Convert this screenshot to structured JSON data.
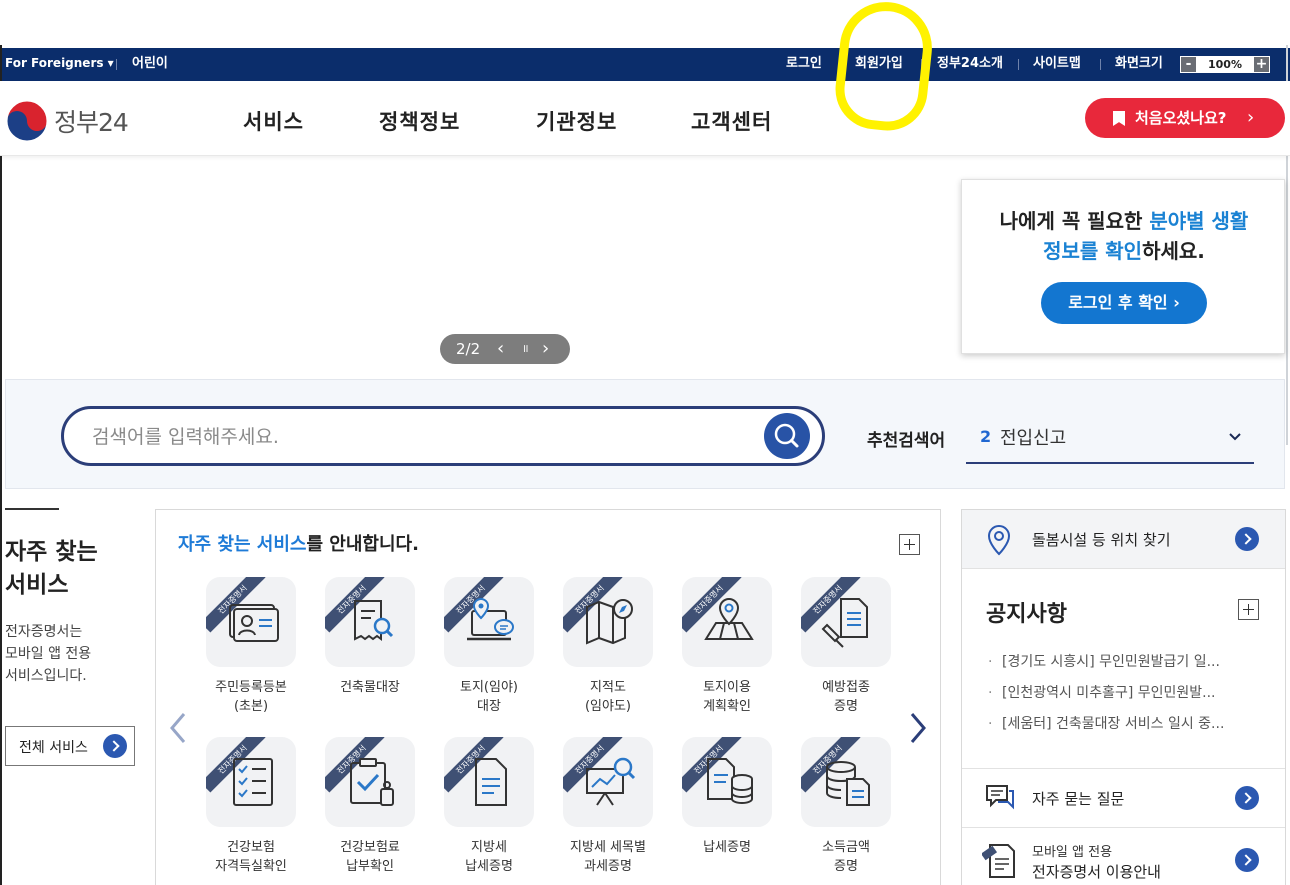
{
  "topbar": {
    "for_foreigners": "For Foreigners ▾",
    "kids": "어린이",
    "login": "로그인",
    "signup": "회원가입",
    "about": "정부24소개",
    "sitemap": "사이트맵",
    "screen_size": "화면크기",
    "zoom_minus": "-",
    "zoom_value": "100%",
    "zoom_plus": "+"
  },
  "header": {
    "logo_text": "정부24",
    "nav": [
      "서비스",
      "정책정보",
      "기관정보",
      "고객센터"
    ],
    "first_visit": "처음오셨나요?",
    "first_visit_arrow": "›"
  },
  "banner": {
    "info_line1_a": "나에게 꼭 필요한 ",
    "info_line1_b": "분야별 생활",
    "info_line2_b": "정보를 확인",
    "info_line2_a": "하세요.",
    "login_check_button": "로그인 후 확인 ›",
    "pager_text": "2/2",
    "pager_prev": "‹",
    "pager_pause": "॥",
    "pager_next": "›"
  },
  "search": {
    "placeholder": "검색어를 입력해주세요.",
    "recommended_label": "추천검색어",
    "recommended_rank": "2",
    "recommended_value": "전입신고"
  },
  "left": {
    "heading_line1": "자주 찾는",
    "heading_line2": "서비스",
    "desc_line1": "전자증명서는",
    "desc_line2": "모바일 앱 전용",
    "desc_line3": "서비스입니다.",
    "all_services": "전체 서비스"
  },
  "services": {
    "title_highlight": "자주 찾는 서비스",
    "title_rest": "를 안내합니다.",
    "ribbon_label": "전자증명서",
    "items": [
      {
        "label": "주민등록등본\n(초본)",
        "icon": "id-card-icon"
      },
      {
        "label": "건축물대장",
        "icon": "document-search-icon"
      },
      {
        "label": "토지(임야)\n대장",
        "icon": "laptop-location-icon"
      },
      {
        "label": "지적도\n(임야도)",
        "icon": "map-compass-icon"
      },
      {
        "label": "토지이용\n계획확인",
        "icon": "map-pin-icon"
      },
      {
        "label": "예방접종\n증명",
        "icon": "syringe-document-icon"
      },
      {
        "label": "건강보험\n자격득실확인",
        "icon": "checklist-icon"
      },
      {
        "label": "건강보험료\n납부확인",
        "icon": "clipboard-check-icon"
      },
      {
        "label": "지방세\n납세증명",
        "icon": "document-icon"
      },
      {
        "label": "지방세 세목별\n과세증명",
        "icon": "chart-board-icon"
      },
      {
        "label": "납세증명",
        "icon": "document-coins-icon"
      },
      {
        "label": "소득금액\n증명",
        "icon": "database-document-icon"
      }
    ]
  },
  "right": {
    "care_location": "돌봄시설 등 위치 찾기",
    "notice_title": "공지사항",
    "notices": [
      "[경기도 시흥시] 무인민원발급기 일...",
      "[인천광역시 미추홀구] 무인민원발...",
      "[세움터] 건축물대장 서비스 일시 중..."
    ],
    "faq": "자주 묻는 질문",
    "mobile_small": "모바일 앱 전용",
    "mobile_main": "전자증명서 이용안내"
  }
}
